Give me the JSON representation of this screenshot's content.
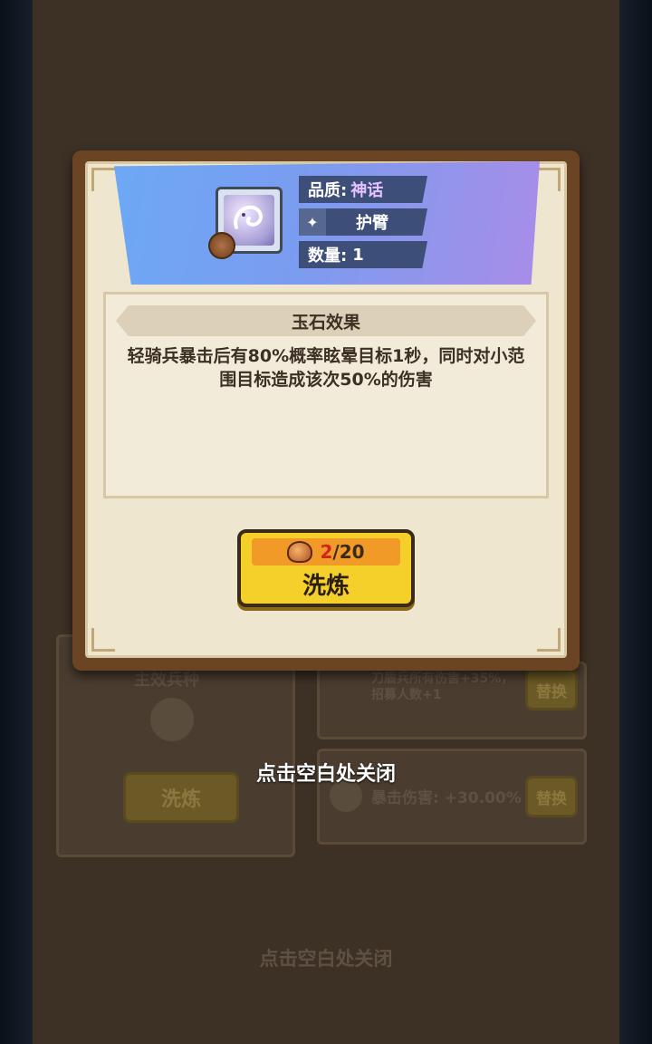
{
  "background": {
    "card_left_title": "主效兵种",
    "card_left_button": "洗炼",
    "card_right_row1": "刀盾兵所有伤害+35%，招募人数+1",
    "card_right_row2": "暴击伤害: +30.00%",
    "swap_label": "替换",
    "bottom_hint": "点击空白处关闭"
  },
  "dialog": {
    "quality_label": "品质:",
    "quality_value": "神话",
    "slot_name": "护臂",
    "count_label": "数量:",
    "count_value": "1",
    "effect_title": "玉石效果",
    "effect_description": "轻骑兵暴击后有80%概率眩晕目标1秒，同时对小范围目标造成该次50%的伤害",
    "refine": {
      "cost_have": "2",
      "cost_total": "/20",
      "label": "洗炼"
    }
  },
  "close_hint": "点击空白处关闭",
  "icons": {
    "item": "jade-dragon-icon",
    "badge": "jade-badge-icon",
    "slot": "wolf-slot-icon",
    "cost": "tiger-coin-icon"
  },
  "colors": {
    "quality_mythic": "#e5c3ff",
    "button_yellow": "#f5d02a",
    "cost_have_red": "#d1241c"
  }
}
